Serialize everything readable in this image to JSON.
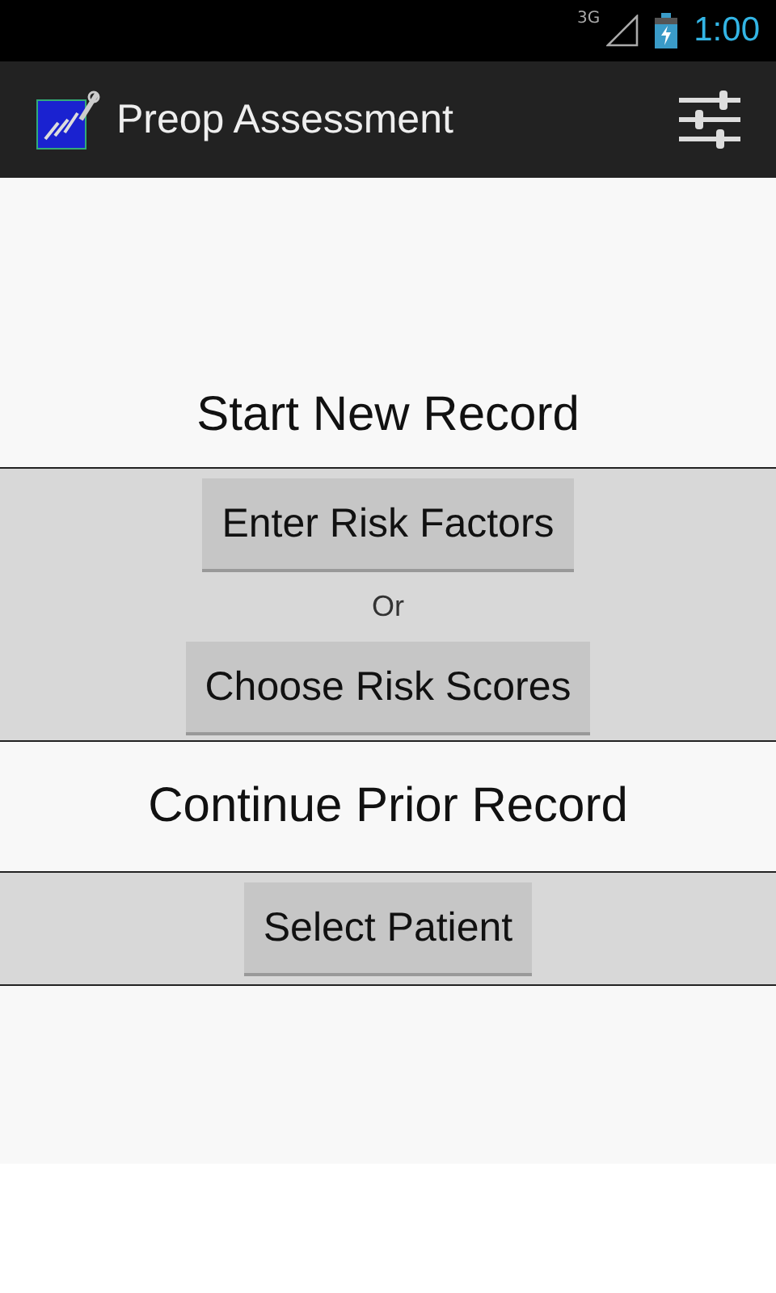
{
  "status_bar": {
    "network": "3G",
    "time": "1:00"
  },
  "action_bar": {
    "title": "Preop Assessment"
  },
  "new_record": {
    "heading": "Start New Record",
    "buttons": [
      "Enter Risk Factors",
      "Choose Risk Scores"
    ],
    "separator": "Or"
  },
  "prior_record": {
    "heading": "Continue Prior Record",
    "buttons": [
      "Select Patient"
    ]
  }
}
